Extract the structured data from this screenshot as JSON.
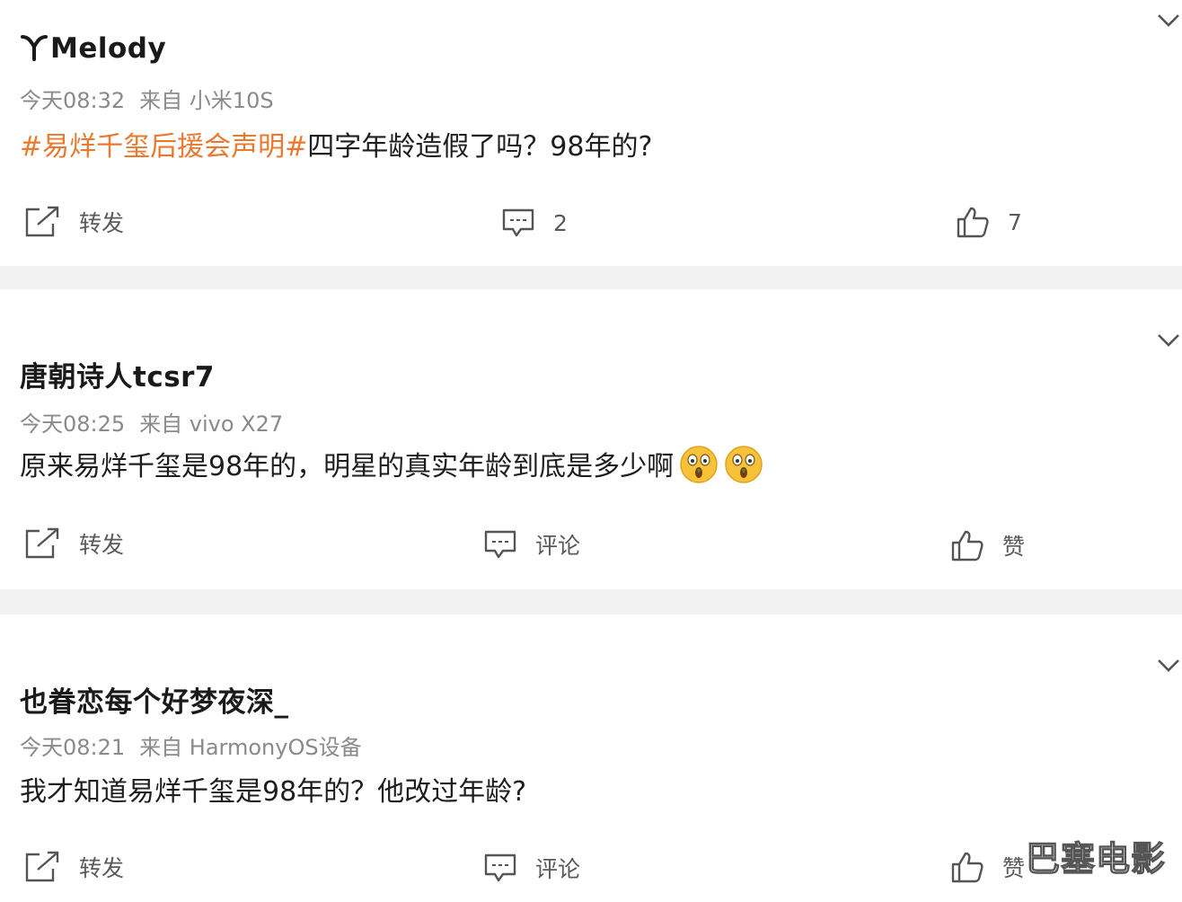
{
  "posts": [
    {
      "username": "Melody",
      "time": "今天08:32",
      "source": "来自 小米10S",
      "topic": "#易烊千玺后援会声明#",
      "text": "四字年龄造假了吗？98年的?",
      "actions": {
        "repost": "转发",
        "comment": "2",
        "like": "7"
      }
    },
    {
      "username": "唐朝诗人tcsr7",
      "time": "今天08:25",
      "source": "来自 vivo X27",
      "text": "原来易烊千玺是98年的，明星的真实年龄到底是多少啊",
      "emojis": [
        "astonished-emoji",
        "astonished-emoji"
      ],
      "actions": {
        "repost": "转发",
        "comment": "评论",
        "like": "赞"
      }
    },
    {
      "username": "也眷恋每个好梦夜深_",
      "time": "今天08:21",
      "source": "来自 HarmonyOS设备",
      "text": "我才知道易烊千玺是98年的？他改过年龄?",
      "actions": {
        "repost": "转发",
        "comment": "评论",
        "like": "赞"
      }
    }
  ],
  "watermark": "巴塞电影",
  "colors": {
    "topic": "#e8792f",
    "meta": "#8a8a8a",
    "divider": "#f2f2f2"
  }
}
